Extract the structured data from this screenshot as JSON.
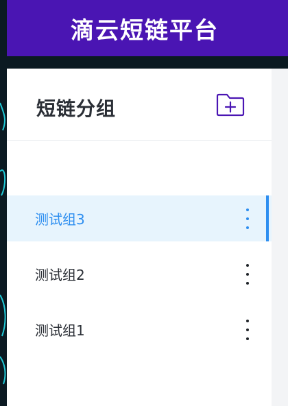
{
  "header": {
    "title": "滴云短链平台"
  },
  "panel": {
    "title": "短链分组",
    "add_icon": "folder-plus-icon"
  },
  "groups": [
    {
      "label": "测试组3",
      "active": true,
      "menu_icon": "more-vertical-icon"
    },
    {
      "label": "测试组2",
      "active": false,
      "menu_icon": "more-vertical-icon"
    },
    {
      "label": "测试组1",
      "active": false,
      "menu_icon": "more-vertical-icon"
    }
  ],
  "colors": {
    "header_bg": "#4a15b3",
    "accent": "#2d8ef0",
    "active_bg": "#e7f4fd",
    "icon_purple": "#4a15b3"
  }
}
